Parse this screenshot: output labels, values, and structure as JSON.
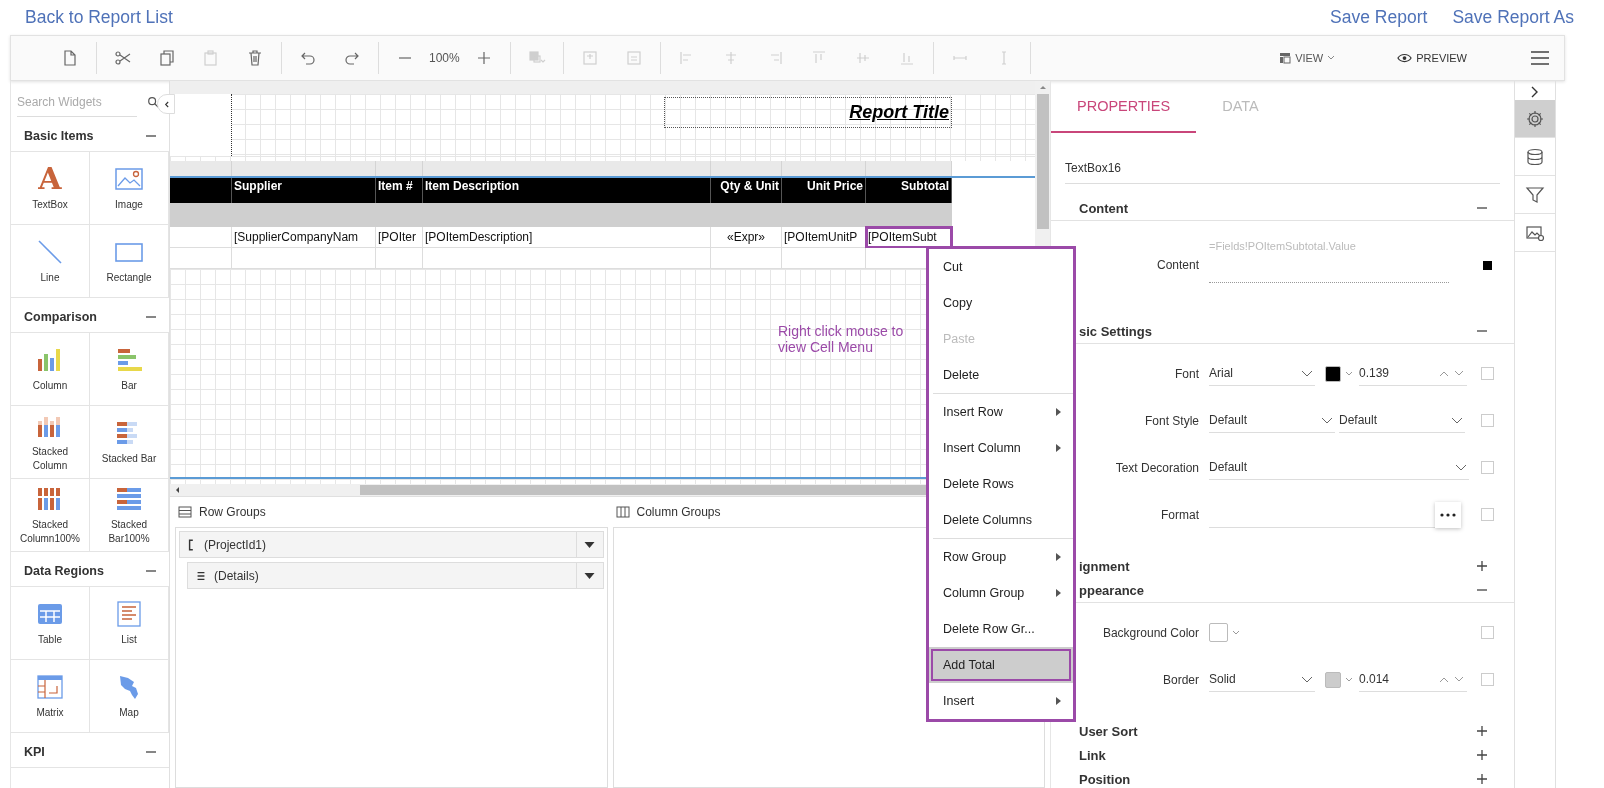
{
  "top_links": {
    "back": "Back to Report List",
    "save": "Save Report",
    "save_as": "Save Report As"
  },
  "toolbar": {
    "items": [
      {
        "kind": "new",
        "disabled": false
      },
      {
        "kind": "sep"
      },
      {
        "kind": "cut",
        "disabled": false
      },
      {
        "kind": "copy",
        "disabled": false
      },
      {
        "kind": "paste",
        "disabled": true
      },
      {
        "kind": "delete",
        "disabled": false
      },
      {
        "kind": "sep"
      },
      {
        "kind": "undo",
        "disabled": false
      },
      {
        "kind": "redo",
        "disabled": false
      },
      {
        "kind": "sep"
      },
      {
        "kind": "zoom-out",
        "disabled": false
      },
      {
        "kind": "zoom-value",
        "text": "100%"
      },
      {
        "kind": "zoom-in",
        "disabled": false
      },
      {
        "kind": "sep"
      },
      {
        "kind": "arrange",
        "disabled": true
      },
      {
        "kind": "sep"
      },
      {
        "kind": "insert-above",
        "disabled": true
      },
      {
        "kind": "insert-below",
        "disabled": true
      },
      {
        "kind": "sep"
      },
      {
        "kind": "align-left",
        "disabled": true
      },
      {
        "kind": "align-center",
        "disabled": true
      },
      {
        "kind": "align-right",
        "disabled": true
      },
      {
        "kind": "align-top",
        "disabled": true
      },
      {
        "kind": "align-middle",
        "disabled": true
      },
      {
        "kind": "align-bottom",
        "disabled": true
      },
      {
        "kind": "sep"
      },
      {
        "kind": "same-width",
        "disabled": true
      },
      {
        "kind": "same-height",
        "disabled": true
      },
      {
        "kind": "sep"
      }
    ],
    "view_label": "VIEW",
    "preview_label": "PREVIEW"
  },
  "widgets": {
    "search_placeholder": "Search Widgets",
    "categories": [
      {
        "title": "Basic Items",
        "expanded": true,
        "items": [
          {
            "label": "TextBox",
            "kind": "textbox",
            "glyph": "A"
          },
          {
            "label": "Image",
            "kind": "image"
          },
          {
            "label": "Line",
            "kind": "line"
          },
          {
            "label": "Rectangle",
            "kind": "rectangle"
          }
        ]
      },
      {
        "title": "Comparison",
        "expanded": true,
        "items": [
          {
            "label": "Column",
            "kind": "column"
          },
          {
            "label": "Bar",
            "kind": "bar"
          },
          {
            "label": "Stacked Column",
            "kind": "stacked-column"
          },
          {
            "label": "Stacked Bar",
            "kind": "stacked-bar"
          },
          {
            "label": "Stacked Column100%",
            "kind": "stacked-column-100"
          },
          {
            "label": "Stacked Bar100%",
            "kind": "stacked-bar-100"
          }
        ]
      },
      {
        "title": "Data Regions",
        "expanded": true,
        "items": [
          {
            "label": "Table",
            "kind": "table"
          },
          {
            "label": "List",
            "kind": "list"
          },
          {
            "label": "Matrix",
            "kind": "matrix"
          },
          {
            "label": "Map",
            "kind": "map"
          }
        ]
      },
      {
        "title": "KPI",
        "expanded": true
      }
    ]
  },
  "report": {
    "title": "Report Title",
    "columns": [
      {
        "selected": false
      },
      {
        "header": "Supplier",
        "detail": "[SupplierCompanyNam",
        "selected": false
      },
      {
        "header": "Item #",
        "detail": "[POIter",
        "selected": false
      },
      {
        "header": "Item Description",
        "detail": "[POItemDescription]",
        "selected": false
      },
      {
        "header": "Qty & Unit",
        "detail": "«Expr»",
        "selected": false
      },
      {
        "header": "Unit Price",
        "detail": "[POItemUnitP",
        "selected": false
      },
      {
        "header": "Subtotal",
        "detail": "[POItemSubt",
        "selected": true
      }
    ]
  },
  "annotation": "Right click mouse to view Cell Menu",
  "context_menu": [
    [
      {
        "label": "Cut",
        "disabled": false,
        "submenu": false,
        "selected": false
      },
      {
        "label": "Copy",
        "disabled": false,
        "submenu": false,
        "selected": false
      },
      {
        "label": "Paste",
        "disabled": true,
        "submenu": false,
        "selected": false
      },
      {
        "label": "Delete",
        "disabled": false,
        "submenu": false,
        "selected": false
      }
    ],
    [
      {
        "label": "Insert Row",
        "disabled": false,
        "submenu": true,
        "selected": false
      },
      {
        "label": "Insert Column",
        "disabled": false,
        "submenu": true,
        "selected": false
      },
      {
        "label": "Delete Rows",
        "disabled": false,
        "submenu": false,
        "selected": false
      },
      {
        "label": "Delete Columns",
        "disabled": false,
        "submenu": false,
        "selected": false
      }
    ],
    [
      {
        "label": "Row Group",
        "disabled": false,
        "submenu": true,
        "selected": false
      },
      {
        "label": "Column Group",
        "disabled": false,
        "submenu": true,
        "selected": false
      },
      {
        "label": "Delete Row Gr...",
        "disabled": false,
        "submenu": false,
        "selected": false
      },
      {
        "label": "Add Total",
        "disabled": false,
        "submenu": false,
        "selected": true
      },
      {
        "label": "Insert",
        "disabled": false,
        "submenu": true,
        "selected": false
      }
    ]
  ],
  "groups_panel": {
    "row_title": "Row Groups",
    "column_title": "Column Groups",
    "row_groups": [
      {
        "label": "(ProjectId1)",
        "kind": "group",
        "children": [
          {
            "label": "(Details)",
            "kind": "details"
          }
        ]
      }
    ]
  },
  "properties": {
    "tabs": [
      {
        "label": "PROPERTIES",
        "selected": true
      },
      {
        "label": "DATA",
        "selected": false
      }
    ],
    "name_value": "TextBox16",
    "sections": [
      {
        "title": "Content",
        "expanded": true,
        "rows": [
          {
            "kind": "expression",
            "label": "Content",
            "value": "=Fields!POItemSubtotal.Value"
          }
        ]
      },
      {
        "title": "sic Settings",
        "expanded": true,
        "rows": [
          {
            "kind": "font",
            "label": "Font",
            "value": "Arial",
            "color": "#000000",
            "size": "0.139",
            "checked": false
          },
          {
            "kind": "pair",
            "label": "Font Style",
            "values": [
              "Default",
              "Default"
            ],
            "checked": false
          },
          {
            "kind": "dropdown",
            "label": "Text Decoration",
            "value": "Default",
            "checked": false
          },
          {
            "kind": "format",
            "label": "Format",
            "checked": false
          }
        ]
      },
      {
        "title": "ignment",
        "expanded": false
      },
      {
        "title": "ppearance",
        "expanded": true,
        "rows": [
          {
            "kind": "color",
            "label": "Background Color",
            "color": "#ffffff",
            "checked": false
          },
          {
            "kind": "font",
            "label": "Border",
            "value": "Solid",
            "color": "#cccccc",
            "size": "0.014",
            "checked": false
          }
        ]
      },
      {
        "title": "User Sort",
        "expanded": false
      },
      {
        "title": "Link",
        "expanded": false
      },
      {
        "title": "Position",
        "expanded": false
      }
    ]
  },
  "side_strip": [
    {
      "kind": "gear",
      "selected": true
    },
    {
      "kind": "database",
      "selected": false
    },
    {
      "kind": "filter",
      "selected": false
    },
    {
      "kind": "image",
      "selected": false
    }
  ]
}
